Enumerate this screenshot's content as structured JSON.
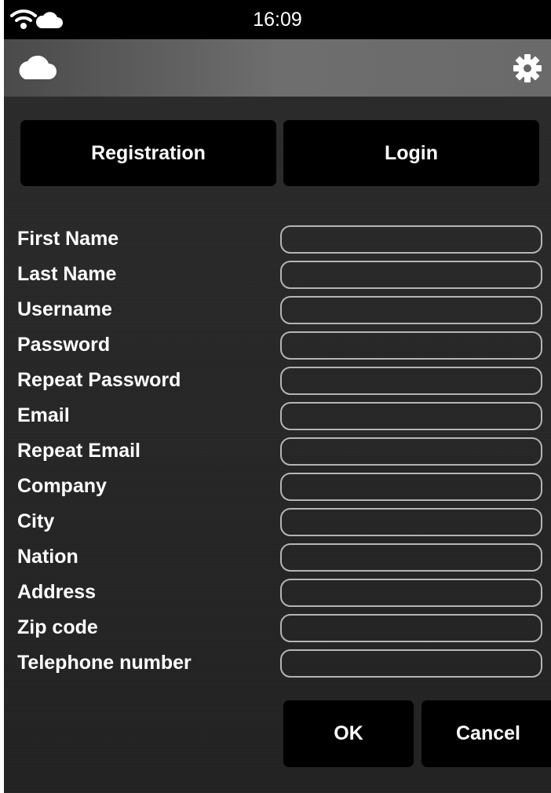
{
  "status_bar": {
    "time": "16:09",
    "icons": [
      "wifi-icon",
      "cloud-icon"
    ]
  },
  "app_bar": {
    "icons": [
      "cloud-icon",
      "gear-icon"
    ]
  },
  "tabs": [
    {
      "label": "Registration"
    },
    {
      "label": "Login"
    }
  ],
  "form": {
    "fields": [
      {
        "label": "First Name",
        "value": ""
      },
      {
        "label": "Last Name",
        "value": ""
      },
      {
        "label": "Username",
        "value": ""
      },
      {
        "label": "Password",
        "value": ""
      },
      {
        "label": "Repeat Password",
        "value": ""
      },
      {
        "label": "Email",
        "value": ""
      },
      {
        "label": "Repeat Email",
        "value": ""
      },
      {
        "label": "Company",
        "value": ""
      },
      {
        "label": "City",
        "value": ""
      },
      {
        "label": "Nation",
        "value": ""
      },
      {
        "label": "Address",
        "value": ""
      },
      {
        "label": "Zip code",
        "value": ""
      },
      {
        "label": "Telephone number",
        "value": ""
      }
    ]
  },
  "actions": {
    "ok_label": "OK",
    "cancel_label": "Cancel"
  },
  "colors": {
    "status_bar_bg": "#000000",
    "app_bar_gradient_start": "#4a4a4a",
    "app_bar_gradient_end": "#6a6a6a",
    "background": "#262626",
    "button_bg": "#000000",
    "text": "#ffffff",
    "input_border": "#b4b4b4"
  }
}
